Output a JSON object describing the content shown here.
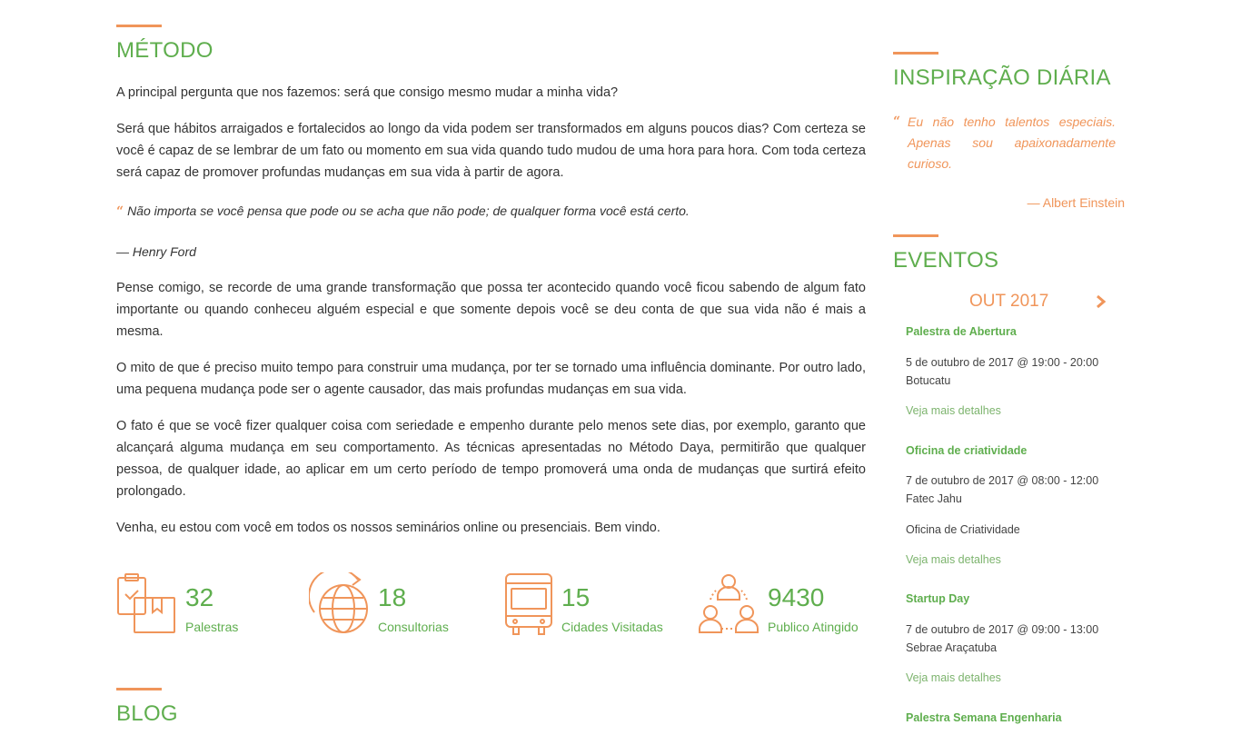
{
  "metodo": {
    "heading": "MÉTODO",
    "intro": "A principal pergunta que nos fazemos: será que consigo mesmo mudar a minha vida?",
    "p1": "Será que hábitos arraigados e fortalecidos ao longo da vida podem ser transformados em alguns poucos dias? Com certeza se você é capaz de se lembrar de um fato ou momento em sua vida quando tudo mudou de uma hora para hora. Com toda certeza será capaz de promover profundas mudanças em sua vida à partir de agora.",
    "quote": "Não importa se você pensa que pode ou se acha que não pode; de qualquer forma você está certo.",
    "quote_author": "— Henry Ford",
    "p2": "Pense comigo, se recorde de uma grande transformação que possa ter acontecido quando você ficou sabendo de algum fato importante ou quando conheceu alguém especial e que somente depois você se deu conta de que sua vida não é mais a mesma.",
    "p3": "O mito de que é preciso muito tempo para construir uma mudança, por ter se tornado uma influência dominante. Por outro lado, uma pequena mudança pode ser o agente causador, das mais profundas mudanças em sua vida.",
    "p4": "O fato é que se você fizer qualquer coisa com seriedade e empenho durante pelo menos sete dias, por exemplo, garanto que alcançará alguma mudança em seu comportamento. As técnicas apresentadas no Método Daya, permitirão que qualquer pessoa, de qualquer idade, ao aplicar em um certo período de tempo promoverá uma onda de mudanças que surtirá efeito prolongado.",
    "p5": "Venha, eu estou com você em todos os nossos seminários online ou presenciais. Bem vindo."
  },
  "stats": [
    {
      "value": "32",
      "label": "Palestras",
      "icon": "clipboard-book-icon"
    },
    {
      "value": "18",
      "label": "Consultorias",
      "icon": "globe-arrow-icon"
    },
    {
      "value": "15",
      "label": "Cidades Visitadas",
      "icon": "bus-icon"
    },
    {
      "value": "9430",
      "label": "Publico Atingido",
      "icon": "people-group-icon"
    }
  ],
  "blog": {
    "heading": "BLOG"
  },
  "inspiracao": {
    "heading": "INSPIRAÇÃO DIÁRIA",
    "quote": "Eu não tenho talentos especiais. Apenas sou apaixonadamente curioso.",
    "author": "— Albert Einstein"
  },
  "eventos": {
    "heading": "EVENTOS",
    "month": "OUT 2017",
    "items": [
      {
        "title": "Palestra de Abertura",
        "date": "5 de outubro de 2017 @ 19:00 - 20:00",
        "place": "Botucatu",
        "link": "Veja mais detalhes"
      },
      {
        "title": "Oficina de criatividade",
        "date": "7 de outubro de 2017 @ 08:00 - 12:00",
        "place": "Fatec Jahu",
        "desc": "Oficina de Criatividade",
        "link": "Veja mais detalhes"
      },
      {
        "title": "Startup Day",
        "date": "7 de outubro de 2017 @ 09:00 - 13:00",
        "place": "Sebrae Araçatuba",
        "link": "Veja mais detalhes"
      },
      {
        "title": "Palestra Semana Engenharia"
      }
    ]
  },
  "colors": {
    "accent": "#f0955a",
    "green": "#5fae4e"
  }
}
